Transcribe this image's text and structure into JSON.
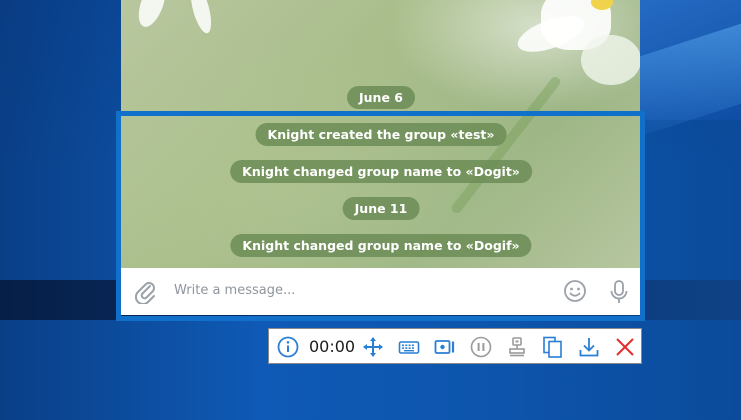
{
  "chat": {
    "dates": [
      "June 6",
      "June 11"
    ],
    "service_messages": [
      "Knight created the group «test»",
      "Knight changed group name to «Dogit»",
      "Knight changed group name to «Dogif»"
    ]
  },
  "composer": {
    "placeholder": "Write a message..."
  },
  "recorder": {
    "timer": "00:00",
    "colors": {
      "frame": "#1170c9",
      "icon": "#2a7fd4",
      "close": "#e0302e",
      "disabled": "#9a9a9a"
    },
    "icons": [
      "info-icon",
      "move-icon",
      "keyboard-icon",
      "webcam-icon",
      "pause-icon",
      "stamp-icon",
      "copy-icon",
      "download-icon",
      "close-icon"
    ]
  }
}
